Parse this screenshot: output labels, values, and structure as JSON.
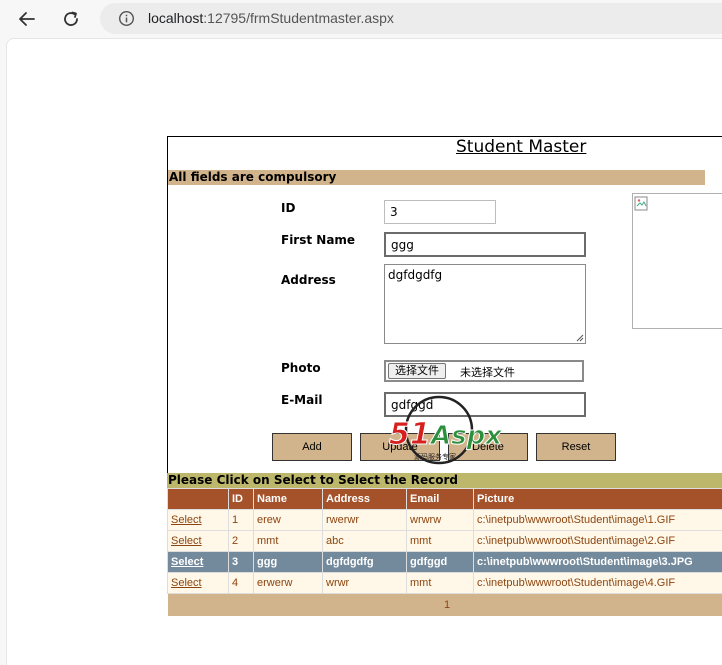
{
  "browser": {
    "url_host": "localhost",
    "url_rest": ":12795/frmStudentmaster.aspx"
  },
  "form": {
    "title": "Student Master",
    "notice": "All fields are compulsory",
    "labels": {
      "id": "ID",
      "first_name": "First Name",
      "address": "Address",
      "photo": "Photo",
      "email": "E-Mail"
    },
    "values": {
      "id": "3",
      "first_name": "ggg",
      "address": "dgfdgdfg",
      "email": "gdfggd"
    },
    "file": {
      "button_label": "选择文件",
      "status": "未选择文件"
    },
    "buttons": {
      "add": "Add",
      "update": "Update",
      "delete": "Delete",
      "reset": "Reset"
    }
  },
  "grid": {
    "caption": "Please Click on Select to Select the Record",
    "columns": [
      "",
      "ID",
      "Name",
      "Address",
      "Email",
      "Picture"
    ],
    "rows": [
      {
        "select": "Select",
        "id": "1",
        "name": "erew",
        "address": "rwerwr",
        "email": "wrwrw",
        "picture": "c:\\inetpub\\wwwroot\\Student\\image\\1.GIF"
      },
      {
        "select": "Select",
        "id": "2",
        "name": "mmt",
        "address": "abc",
        "email": "mmt",
        "picture": "c:\\inetpub\\wwwroot\\Student\\image\\2.GIF"
      },
      {
        "select": "Select",
        "id": "3",
        "name": "ggg",
        "address": "dgfdgdfg",
        "email": "gdfggd",
        "picture": "c:\\inetpub\\wwwroot\\Student\\image\\3.JPG"
      },
      {
        "select": "Select",
        "id": "4",
        "name": "erwerw",
        "address": "wrwr",
        "email": "mmt",
        "picture": "c:\\inetpub\\wwwroot\\Student\\image\\4.GIF"
      }
    ],
    "selected_index": 2,
    "pager": "1"
  },
  "watermark": {
    "brand": "51Aspx",
    "tagline": "源码服务专家"
  },
  "colors": {
    "header": "#a55129",
    "row": "#fff7e7",
    "selected": "#738a9c",
    "tan": "#d2b48c",
    "caption": "#bdb76b"
  }
}
